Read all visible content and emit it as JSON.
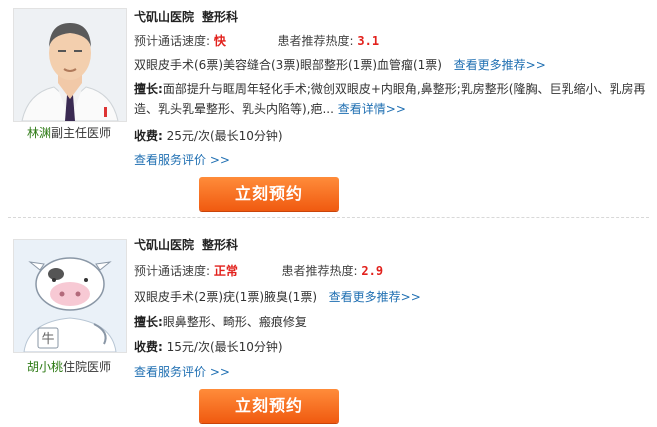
{
  "doctors": [
    {
      "name": "林渊",
      "title": "副主任医师",
      "hospital": "弋矶山医院",
      "department": "整形科",
      "speed_label": "预计通话速度:",
      "speed_value": "快",
      "heat_label": "患者推荐热度:",
      "heat_value": "3.1",
      "tags": "双眼皮手术(6票)美容缝合(3票)眼部整形(1票)血管瘤(1票)",
      "more_recommend": "查看更多推荐>>",
      "skill_label": "擅长:",
      "skill_text": "面部提升与眶周年轻化手术;微创双眼皮+内眼角,鼻整形;乳房整形(隆胸、巨乳缩小、乳房再造、乳头乳晕整形、乳头内陷等),疤...",
      "skill_more": "查看详情>>",
      "fee_label": "收费:",
      "fee_value": "25元/次(最长10分钟)",
      "review_link": "查看服务评价 >>",
      "book_button": "立刻预约"
    },
    {
      "name": "胡小桃",
      "title": "住院医师",
      "hospital": "弋矶山医院",
      "department": "整形科",
      "speed_label": "预计通话速度:",
      "speed_value": "正常",
      "heat_label": "患者推荐热度:",
      "heat_value": "2.9",
      "tags": "双眼皮手术(2票)疣(1票)腋臭(1票)",
      "more_recommend": "查看更多推荐>>",
      "skill_label": "擅长:",
      "skill_text": "眼鼻整形、畸形、瘢痕修复",
      "fee_label": "收费:",
      "fee_value": "15元/次(最长10分钟)",
      "review_link": "查看服务评价 >>",
      "book_button": "立刻预约"
    }
  ],
  "avatar2_badge": "牛"
}
